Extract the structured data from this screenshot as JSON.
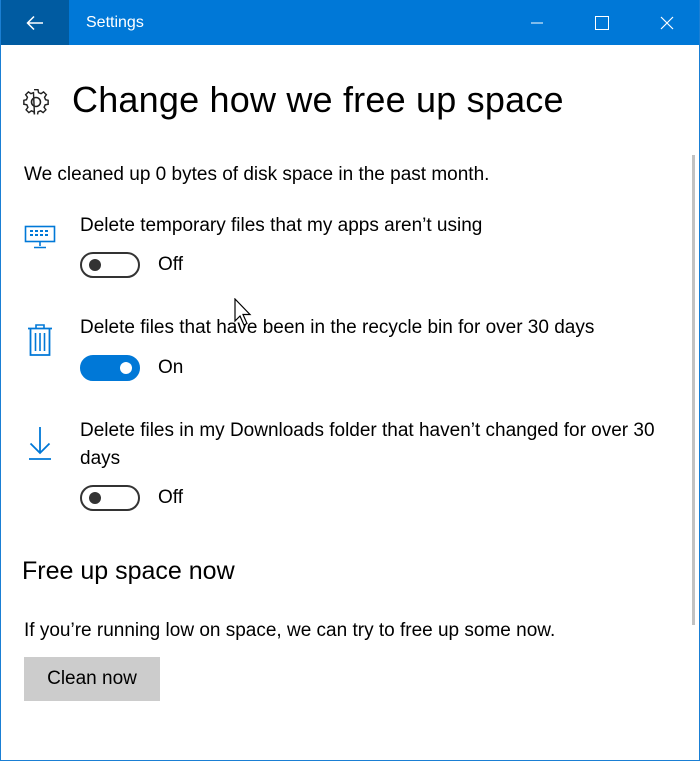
{
  "window": {
    "title": "Settings"
  },
  "page": {
    "title": "Change how we free up space",
    "cleaned_summary": "We cleaned up 0 bytes of disk space in the past month."
  },
  "options": [
    {
      "label": "Delete temporary files that my apps aren’t using",
      "state": "Off",
      "icon": "monitor-icon"
    },
    {
      "label": "Delete files that have been in the recycle bin for over 30 days",
      "state": "On",
      "icon": "trash-icon"
    },
    {
      "label": "Delete files in my Downloads folder that haven’t changed for over 30 days",
      "state": "Off",
      "icon": "download-icon"
    }
  ],
  "free_now": {
    "title": "Free up space now",
    "description": "If you’re running low on space, we can try to free up some now.",
    "button_label": "Clean now"
  },
  "colors": {
    "accent": "#0078d7",
    "back_button": "#005ba1",
    "button_gray": "#cccccc"
  }
}
